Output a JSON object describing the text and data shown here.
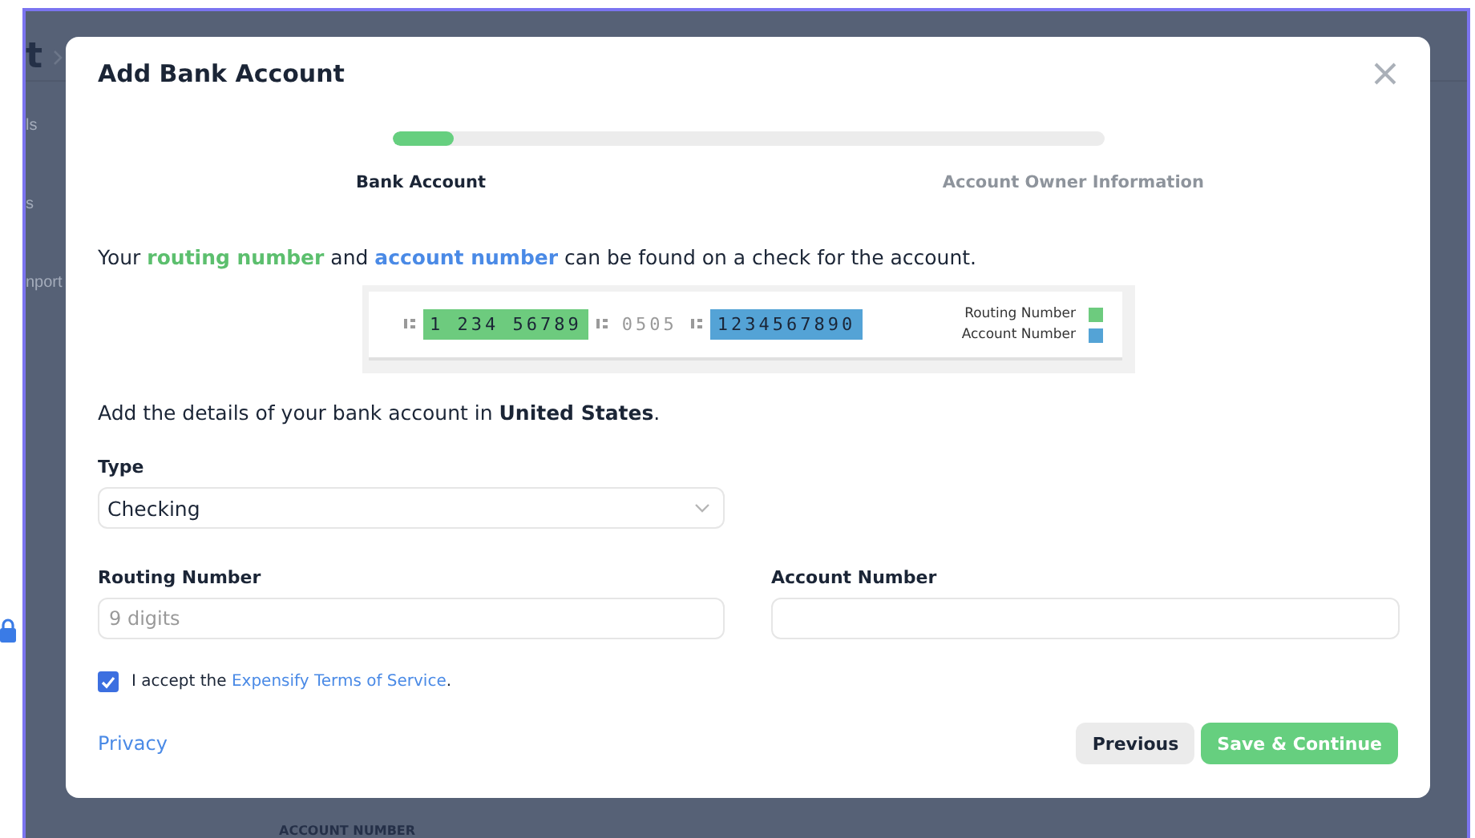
{
  "background": {
    "header_title": "t",
    "sidebar_items": [
      "ls",
      "s",
      "nport"
    ],
    "column_header": "ACCOUNT NUMBER"
  },
  "modal": {
    "title": "Add Bank Account",
    "progress": {
      "level": 0.085
    },
    "steps": [
      {
        "label": "Bank Account",
        "selected": true
      },
      {
        "label": "Account Owner Information",
        "selected": false
      }
    ],
    "hint_parts": [
      {
        "text": "Your ",
        "kind": "plain"
      },
      {
        "text": "routing number",
        "kind": "routing"
      },
      {
        "text": " and ",
        "kind": "plain"
      },
      {
        "text": "account number",
        "kind": "account"
      },
      {
        "text": " can be found on a check for the account.",
        "kind": "plain"
      }
    ],
    "check": {
      "routing": "1 234 56789",
      "check_number": "0505",
      "account": "1234567890",
      "legend": [
        {
          "label": "Routing Number",
          "color": "#6dcb7e"
        },
        {
          "label": "Account Number",
          "color": "#54a3d6"
        }
      ]
    },
    "details": "Add the details of your bank account in **United States**.",
    "type_field": {
      "label": "Type",
      "value": "Checking"
    },
    "routing_field": {
      "label": "Routing Number",
      "placeholder": "9 digits"
    },
    "account_field": {
      "label": "Account Number"
    },
    "terms": {
      "checked": true,
      "prefix": "I accept the ",
      "link": "Expensify Terms of Service",
      "suffix": "."
    },
    "privacy": "Privacy",
    "buttons": {
      "previous": "Previous",
      "save": "Save & Continue"
    }
  }
}
